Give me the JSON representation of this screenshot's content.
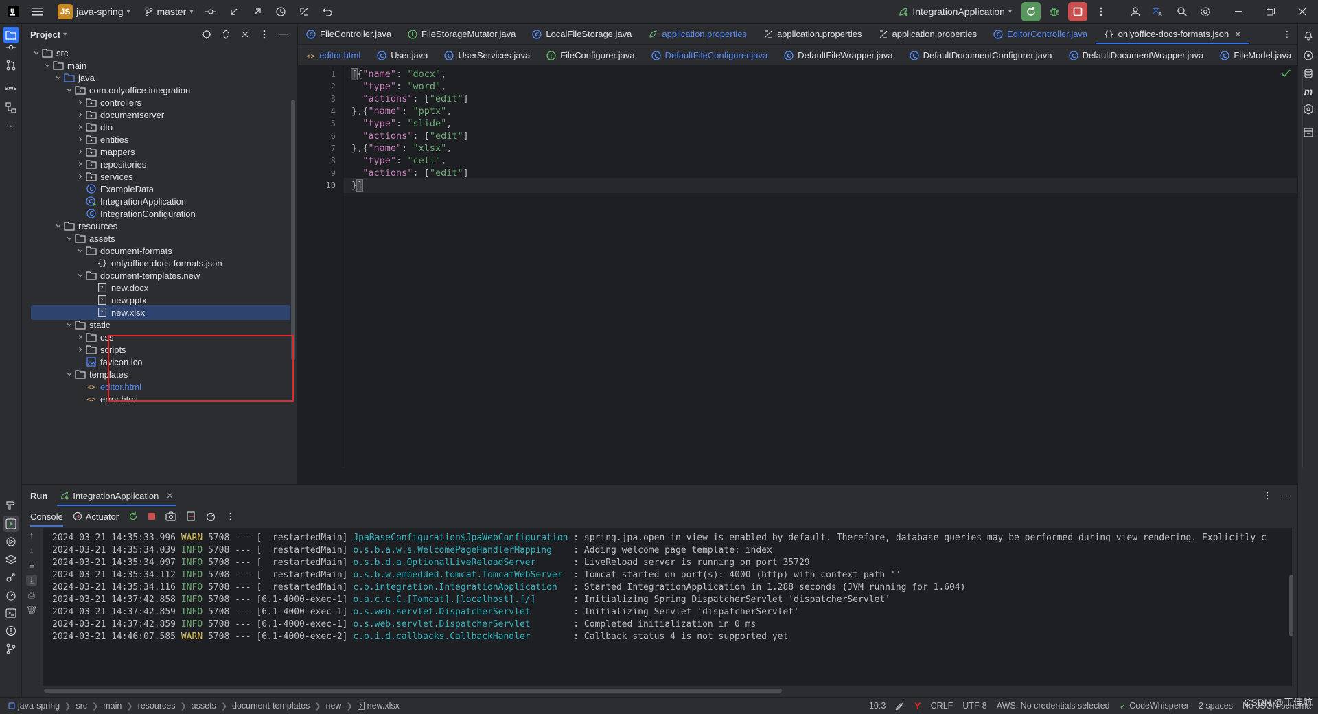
{
  "titlebar": {
    "project_badge": "JS",
    "project_name": "java-spring",
    "branch": "master",
    "run_config": "IntegrationApplication"
  },
  "project_panel": {
    "title": "Project",
    "tree": [
      {
        "label": "src",
        "kind": "folder",
        "depth": 2,
        "open": true
      },
      {
        "label": "main",
        "kind": "folder",
        "depth": 3,
        "open": true
      },
      {
        "label": "java",
        "kind": "srcfolder",
        "depth": 4,
        "open": true
      },
      {
        "label": "com.onlyoffice.integration",
        "kind": "package",
        "depth": 5,
        "open": true
      },
      {
        "label": "controllers",
        "kind": "package",
        "depth": 6,
        "open": false
      },
      {
        "label": "documentserver",
        "kind": "package",
        "depth": 6,
        "open": false
      },
      {
        "label": "dto",
        "kind": "package",
        "depth": 6,
        "open": false
      },
      {
        "label": "entities",
        "kind": "package",
        "depth": 6,
        "open": false
      },
      {
        "label": "mappers",
        "kind": "package",
        "depth": 6,
        "open": false
      },
      {
        "label": "repositories",
        "kind": "package",
        "depth": 6,
        "open": false
      },
      {
        "label": "services",
        "kind": "package",
        "depth": 6,
        "open": false
      },
      {
        "label": "ExampleData",
        "kind": "class",
        "depth": 6
      },
      {
        "label": "IntegrationApplication",
        "kind": "appclass",
        "depth": 6
      },
      {
        "label": "IntegrationConfiguration",
        "kind": "class",
        "depth": 6
      },
      {
        "label": "resources",
        "kind": "resfolder",
        "depth": 4,
        "open": true
      },
      {
        "label": "assets",
        "kind": "folder",
        "depth": 5,
        "open": true
      },
      {
        "label": "document-formats",
        "kind": "folder",
        "depth": 6,
        "open": true
      },
      {
        "label": "onlyoffice-docs-formats.json",
        "kind": "json",
        "depth": 7
      },
      {
        "label": "document-templates.new",
        "kind": "folder",
        "depth": 6,
        "open": true
      },
      {
        "label": "new.docx",
        "kind": "unknown",
        "depth": 7
      },
      {
        "label": "new.pptx",
        "kind": "unknown",
        "depth": 7
      },
      {
        "label": "new.xlsx",
        "kind": "unknown",
        "depth": 7,
        "selected": true
      },
      {
        "label": "static",
        "kind": "folder",
        "depth": 5,
        "open": true
      },
      {
        "label": "css",
        "kind": "folder",
        "depth": 6,
        "open": false
      },
      {
        "label": "scripts",
        "kind": "folder",
        "depth": 6,
        "open": false
      },
      {
        "label": "favicon.ico",
        "kind": "image",
        "depth": 6
      },
      {
        "label": "templates",
        "kind": "folder",
        "depth": 5,
        "open": true
      },
      {
        "label": "editor.html",
        "kind": "html",
        "depth": 6,
        "link": true
      },
      {
        "label": "error.html",
        "kind": "html",
        "depth": 6
      }
    ]
  },
  "editor_tabs_row1": [
    {
      "label": "FileController.java",
      "icon": "class"
    },
    {
      "label": "FileStorageMutator.java",
      "icon": "interface"
    },
    {
      "label": "LocalFileStorage.java",
      "icon": "class"
    },
    {
      "label": "application.properties",
      "icon": "props",
      "modified": true
    },
    {
      "label": "application.properties",
      "icon": "props-diff"
    },
    {
      "label": "application.properties",
      "icon": "props-diff"
    },
    {
      "label": "EditorController.java",
      "icon": "class",
      "modified": true
    },
    {
      "label": "onlyoffice-docs-formats.json",
      "icon": "json",
      "active": true,
      "closable": true
    }
  ],
  "editor_tabs_row2": [
    {
      "label": "editor.html",
      "icon": "html",
      "modified": true
    },
    {
      "label": "User.java",
      "icon": "class"
    },
    {
      "label": "UserServices.java",
      "icon": "class"
    },
    {
      "label": "FileConfigurer.java",
      "icon": "interface"
    },
    {
      "label": "DefaultFileConfigurer.java",
      "icon": "class",
      "modified": true
    },
    {
      "label": "DefaultFileWrapper.java",
      "icon": "class"
    },
    {
      "label": "DefaultDocumentConfigurer.java",
      "icon": "class"
    },
    {
      "label": "DefaultDocumentWrapper.java",
      "icon": "class"
    },
    {
      "label": "FileModel.java",
      "icon": "class"
    }
  ],
  "code_lines": [
    {
      "n": "1",
      "text": "[{\"name\": \"docx\","
    },
    {
      "n": "2",
      "text": "  \"type\": \"word\","
    },
    {
      "n": "3",
      "text": "  \"actions\": [\"edit\"]"
    },
    {
      "n": "4",
      "text": "},{\"name\": \"pptx\","
    },
    {
      "n": "5",
      "text": "  \"type\": \"slide\","
    },
    {
      "n": "6",
      "text": "  \"actions\": [\"edit\"]"
    },
    {
      "n": "7",
      "text": "},{\"name\": \"xlsx\","
    },
    {
      "n": "8",
      "text": "  \"type\": \"cell\","
    },
    {
      "n": "9",
      "text": "  \"actions\": [\"edit\"]"
    },
    {
      "n": "10",
      "text": "}]",
      "current": true
    }
  ],
  "run_panel": {
    "title": "Run",
    "run_tab": "IntegrationApplication",
    "console_tab": "Console",
    "actuator_tab": "Actuator",
    "logs": [
      {
        "ts": "2024-03-21 14:35:33.996",
        "level": "WARN",
        "pid": "5708",
        "sep": "---",
        "thread": "[  restartedMain]",
        "logger": "JpaBaseConfiguration$JpaWebConfiguration",
        "msg": ": spring.jpa.open-in-view is enabled by default. Therefore, database queries may be performed during view rendering. Explicitly c"
      },
      {
        "ts": "2024-03-21 14:35:34.039",
        "level": "INFO",
        "pid": "5708",
        "sep": "---",
        "thread": "[  restartedMain]",
        "logger": "o.s.b.a.w.s.WelcomePageHandlerMapping",
        "msg": ": Adding welcome page template: index"
      },
      {
        "ts": "2024-03-21 14:35:34.097",
        "level": "INFO",
        "pid": "5708",
        "sep": "---",
        "thread": "[  restartedMain]",
        "logger": "o.s.b.d.a.OptionalLiveReloadServer",
        "msg": ": LiveReload server is running on port 35729"
      },
      {
        "ts": "2024-03-21 14:35:34.112",
        "level": "INFO",
        "pid": "5708",
        "sep": "---",
        "thread": "[  restartedMain]",
        "logger": "o.s.b.w.embedded.tomcat.TomcatWebServer",
        "msg": ": Tomcat started on port(s): 4000 (http) with context path ''"
      },
      {
        "ts": "2024-03-21 14:35:34.116",
        "level": "INFO",
        "pid": "5708",
        "sep": "---",
        "thread": "[  restartedMain]",
        "logger": "c.o.integration.IntegrationApplication",
        "msg": ": Started IntegrationApplication in 1.288 seconds (JVM running for 1.604)"
      },
      {
        "ts": "2024-03-21 14:37:42.858",
        "level": "INFO",
        "pid": "5708",
        "sep": "---",
        "thread": "[6.1-4000-exec-1]",
        "logger": "o.a.c.c.C.[Tomcat].[localhost].[/]",
        "msg": ": Initializing Spring DispatcherServlet 'dispatcherServlet'"
      },
      {
        "ts": "2024-03-21 14:37:42.859",
        "level": "INFO",
        "pid": "5708",
        "sep": "---",
        "thread": "[6.1-4000-exec-1]",
        "logger": "o.s.web.servlet.DispatcherServlet",
        "msg": ": Initializing Servlet 'dispatcherServlet'"
      },
      {
        "ts": "2024-03-21 14:37:42.859",
        "level": "INFO",
        "pid": "5708",
        "sep": "---",
        "thread": "[6.1-4000-exec-1]",
        "logger": "o.s.web.servlet.DispatcherServlet",
        "msg": ": Completed initialization in 0 ms"
      },
      {
        "ts": "2024-03-21 14:46:07.585",
        "level": "WARN",
        "pid": "5708",
        "sep": "---",
        "thread": "[6.1-4000-exec-2]",
        "logger": "c.o.i.d.callbacks.CallbackHandler",
        "msg": ": Callback status 4 is not supported yet"
      }
    ]
  },
  "statusbar": {
    "breadcrumbs": [
      "java-spring",
      "src",
      "main",
      "resources",
      "assets",
      "document-templates",
      "new",
      "new.xlsx"
    ],
    "position": "10:3",
    "line_sep": "CRLF",
    "encoding": "UTF-8",
    "aws": "AWS: No credentials selected",
    "codewhisperer": "CodeWhisperer",
    "indent": "2 spaces",
    "schema": "No JSON schema"
  },
  "watermark": "CSDN @王佳航",
  "colors": {
    "accent": "#3574f0",
    "highlight_box": "#e5262b",
    "selection": "#2e436e",
    "run_green": "#57965c",
    "stop_red": "#c94f4f"
  }
}
